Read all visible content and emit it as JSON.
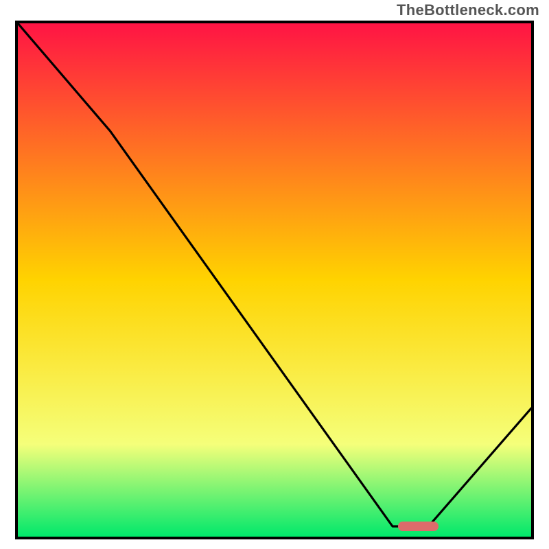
{
  "watermark": "TheBottleneck.com",
  "colors": {
    "gradient_top": "#ff1444",
    "gradient_mid": "#ffd300",
    "gradient_low": "#f5ff7a",
    "gradient_bottom": "#00e86b",
    "curve": "#000000",
    "border": "#000000",
    "marker": "#dd6b6b"
  },
  "chart_data": {
    "type": "line",
    "title": "",
    "xlabel": "",
    "ylabel": "",
    "xlim": [
      0,
      100
    ],
    "ylim": [
      0,
      100
    ],
    "grid": false,
    "legend_position": "none",
    "annotations": [
      "TheBottleneck.com"
    ],
    "series": [
      {
        "name": "bottleneck-curve",
        "x": [
          0,
          18,
          73,
          80,
          100
        ],
        "y": [
          100,
          79,
          2,
          2,
          25
        ]
      }
    ],
    "marker": {
      "name": "recommended-range",
      "x_start": 74,
      "x_end": 82,
      "y": 2
    },
    "background_gradient": {
      "stops": [
        {
          "pos": 0.0,
          "color": "#ff1444"
        },
        {
          "pos": 0.5,
          "color": "#ffd300"
        },
        {
          "pos": 0.82,
          "color": "#f5ff7a"
        },
        {
          "pos": 1.0,
          "color": "#00e86b"
        }
      ]
    }
  }
}
